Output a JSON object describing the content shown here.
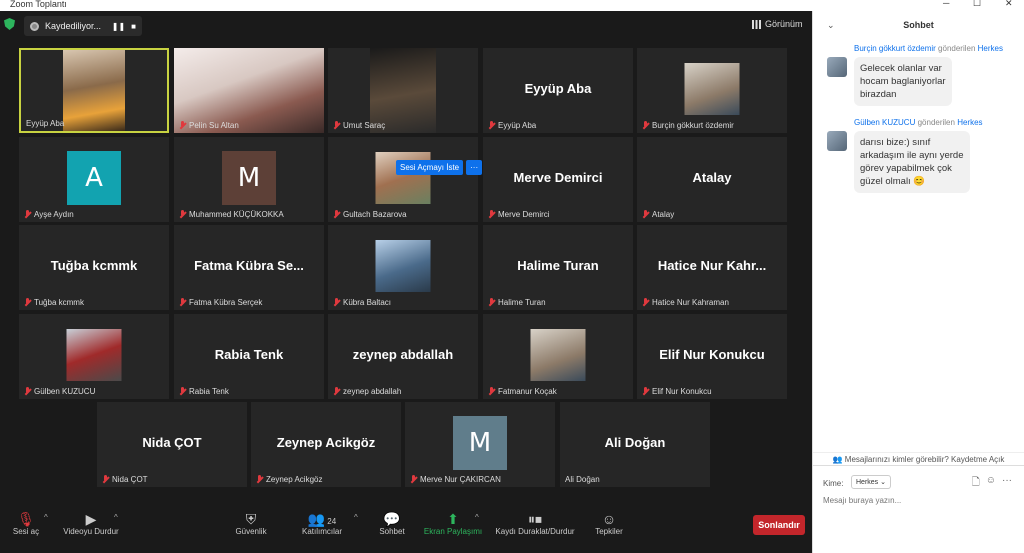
{
  "window": {
    "title": "Zoom Toplantı",
    "controls": [
      "─",
      "☐",
      "✕"
    ]
  },
  "recording": {
    "label": "Kaydediliyor...",
    "pause": "❚❚",
    "stop": "■"
  },
  "view": {
    "label": "Görünüm"
  },
  "popup": {
    "label": "Sesi Açmayı İste",
    "more": "···"
  },
  "tiles": [
    {
      "name": "Eyyüp Aba",
      "kind": "video",
      "muted": false,
      "active": true
    },
    {
      "name": "Pelin Su Altan",
      "kind": "video",
      "muted": true
    },
    {
      "name": "Umut Saraç",
      "kind": "video",
      "muted": true
    },
    {
      "name": "Eyyüp Aba",
      "kind": "text",
      "big": "Eyyüp Aba",
      "muted": true
    },
    {
      "name": "Burçin gökkurt özdemir",
      "kind": "photo",
      "muted": true
    },
    {
      "name": "Ayşe Aydın",
      "kind": "avatar",
      "letter": "A",
      "color": "#12a3b0",
      "muted": true
    },
    {
      "name": "Muhammed KÜÇÜKOKKA",
      "kind": "avatar",
      "letter": "M",
      "color": "#5d4037",
      "muted": true
    },
    {
      "name": "Gultach Bazarova",
      "kind": "photo",
      "muted": true
    },
    {
      "name": "Merve Demirci",
      "kind": "text",
      "big": "Merve Demirci",
      "muted": true
    },
    {
      "name": "Atalay",
      "kind": "text",
      "big": "Atalay",
      "muted": true
    },
    {
      "name": "Tuğba kcmmk",
      "kind": "text",
      "big": "Tuğba kcmmk",
      "muted": true
    },
    {
      "name": "Fatma Kübra Serçek",
      "kind": "text",
      "big": "Fatma  Kübra  Se...",
      "muted": true
    },
    {
      "name": "Kübra Baltacı",
      "kind": "photo",
      "muted": true
    },
    {
      "name": "Halime Turan",
      "kind": "text",
      "big": "Halime Turan",
      "muted": true
    },
    {
      "name": "Hatice Nur Kahraman",
      "kind": "text",
      "big": "Hatice  Nur  Kahr...",
      "muted": true
    },
    {
      "name": "Gülben KUZUCU",
      "kind": "photo",
      "muted": true
    },
    {
      "name": "Rabia Tenk",
      "kind": "text",
      "big": "Rabia Tenk",
      "muted": true
    },
    {
      "name": "zeynep abdallah",
      "kind": "text",
      "big": "zeynep abdallah",
      "muted": true
    },
    {
      "name": "Fatmanur Koçak",
      "kind": "photo",
      "muted": true
    },
    {
      "name": "Elif Nur Konukcu",
      "kind": "text",
      "big": "Elif Nur Konukcu",
      "muted": true
    },
    {
      "name": "Nida ÇOT",
      "kind": "text",
      "big": "Nida ÇOT",
      "muted": true
    },
    {
      "name": "Zeynep Acikgöz",
      "kind": "text",
      "big": "Zeynep Acikgöz",
      "muted": true
    },
    {
      "name": "Merve Nur ÇAKIRCAN",
      "kind": "avatar",
      "letter": "M",
      "color": "#607d8b",
      "muted": true
    },
    {
      "name": "Ali Doğan",
      "kind": "text",
      "big": "Ali Doğan",
      "muted": false
    }
  ],
  "toolbar": {
    "mute": "Sesi aç",
    "video": "Videoyu Durdur",
    "security": "Güvenlik",
    "participants": "Katılımcılar",
    "participants_count": "24",
    "chat": "Sohbet",
    "share": "Ekran Paylaşımı",
    "record": "Kaydı Duraklat/Durdur",
    "reactions": "Tepkiler",
    "end": "Sonlandır"
  },
  "chat": {
    "title": "Sohbet",
    "messages": [
      {
        "from": "Burçin gökkurt özdemir",
        "sent": "gönderilen",
        "to": "Herkes",
        "text": [
          "Gelecek olanlar var",
          "hocam baglaniyorlar",
          "birazdan"
        ]
      },
      {
        "from": "Gülben KUZUCU",
        "sent": "gönderilen",
        "to": "Herkes",
        "text": [
          "darısı bize:)  sınıf",
          "arkadaşım ile aynı yerde",
          "görev yapabilmek çok",
          "güzel olmalı 😊"
        ]
      }
    ],
    "privacy": "Mesajlarınızı kimler görebilir? Kaydetme Açık",
    "to_label": "Kime:",
    "to_value": "Herkes",
    "placeholder": "Mesajı buraya yazın..."
  }
}
